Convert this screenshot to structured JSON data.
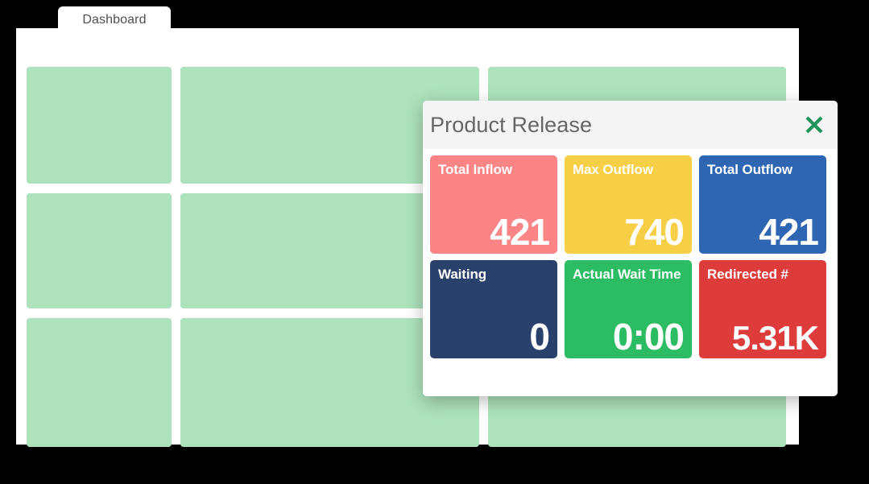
{
  "tab": {
    "label": "Dashboard",
    "name": "dashboard-tab"
  },
  "modal": {
    "title": "Product Release",
    "close_icon": "close-icon",
    "close_color": "#21935c",
    "header_bg": "#f4f4f4",
    "title_color": "#666666"
  },
  "kpis": [
    {
      "label": "Total Inflow",
      "value": "421",
      "color": "#fb8486",
      "name": "kpi-card-total-inflow"
    },
    {
      "label": "Max Outflow",
      "value": "740",
      "color": "#f7cf47",
      "name": "kpi-card-max-outflow"
    },
    {
      "label": "Total Outflow",
      "value": "421",
      "color": "#2f66b3",
      "name": "kpi-card-total-outflow"
    },
    {
      "label": "Waiting",
      "value": "0",
      "color": "#2a426b",
      "name": "kpi-card-waiting"
    },
    {
      "label": "Actual Wait Time",
      "value": "0:00",
      "color": "#2cbc63",
      "name": "kpi-card-actual-wait-time"
    },
    {
      "label": "Redirected #",
      "value": "5.31K",
      "color": "#de3b3b",
      "name": "kpi-card-redirected"
    }
  ],
  "dashboard": {
    "placeholder_color": "#ade2bc",
    "panel_color": "#ffffff",
    "widget_count": 9
  }
}
